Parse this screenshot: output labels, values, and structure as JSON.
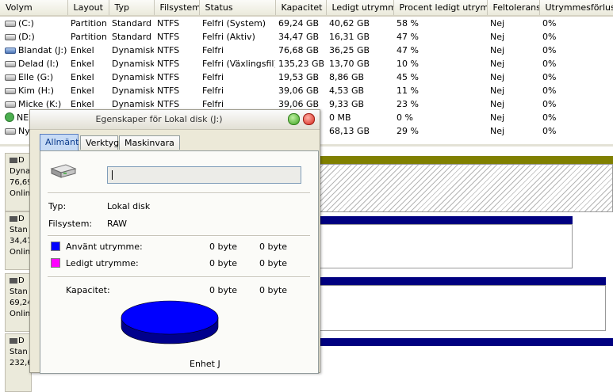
{
  "table": {
    "headers": [
      "Volym",
      "Layout",
      "Typ",
      "Filsystem",
      "Status",
      "Kapacitet",
      "Ledigt utrymme",
      "Procent ledigt utrymme",
      "Feltolerans",
      "Utrymmesförlust"
    ],
    "rows": [
      {
        "icon": "basic-disk-icon",
        "cells": [
          "(C:)",
          "Partition",
          "Standard",
          "NTFS",
          "Felfri (System)",
          "69,24 GB",
          "40,62 GB",
          "58 %",
          "Nej",
          "0%"
        ]
      },
      {
        "icon": "basic-disk-icon",
        "cells": [
          "(D:)",
          "Partition",
          "Standard",
          "NTFS",
          "Felfri (Aktiv)",
          "34,47 GB",
          "16,31 GB",
          "47 %",
          "Nej",
          "0%"
        ]
      },
      {
        "icon": "dynamic-disk-icon",
        "cells": [
          "Blandat (J:)",
          "Enkel",
          "Dynamisk",
          "NTFS",
          "Felfri",
          "76,68 GB",
          "36,25 GB",
          "47 %",
          "Nej",
          "0%"
        ]
      },
      {
        "icon": "basic-disk-icon",
        "cells": [
          "Delad (I:)",
          "Enkel",
          "Dynamisk",
          "NTFS",
          "Felfri (Växlingsfil)",
          "135,23 GB",
          "13,70 GB",
          "10 %",
          "Nej",
          "0%"
        ]
      },
      {
        "icon": "basic-disk-icon",
        "cells": [
          "Elle (G:)",
          "Enkel",
          "Dynamisk",
          "NTFS",
          "Felfri",
          "19,53 GB",
          "8,86 GB",
          "45 %",
          "Nej",
          "0%"
        ]
      },
      {
        "icon": "basic-disk-icon",
        "cells": [
          "Kim (H:)",
          "Enkel",
          "Dynamisk",
          "NTFS",
          "Felfri",
          "39,06 GB",
          "4,53 GB",
          "11 %",
          "Nej",
          "0%"
        ]
      },
      {
        "icon": "basic-disk-icon",
        "cells": [
          "Micke (K:)",
          "Enkel",
          "Dynamisk",
          "NTFS",
          "Felfri",
          "39,06 GB",
          "9,33 GB",
          "23 %",
          "Nej",
          "0%"
        ]
      },
      {
        "icon": "network-drive-icon",
        "cells": [
          "NE",
          "",
          "",
          "",
          "",
          "",
          "0 MB",
          "0 %",
          "Nej",
          "0%"
        ]
      },
      {
        "icon": "basic-disk-icon",
        "cells": [
          "Ny",
          "",
          "",
          "",
          "",
          "",
          "68,13 GB",
          "29 %",
          "Nej",
          "0%"
        ]
      }
    ]
  },
  "disks": [
    {
      "lines": [
        "D",
        "Dyna",
        "76,69",
        "Onlin"
      ]
    },
    {
      "lines": [
        "D",
        "Stan",
        "34,47",
        "Onlin"
      ]
    },
    {
      "lines": [
        "D",
        "Stan",
        "69,24",
        "Onlin"
      ]
    },
    {
      "lines": [
        "D",
        "Stan",
        "232,6"
      ]
    }
  ],
  "dialog": {
    "title": "Egenskaper för Lokal disk (J:)",
    "tabs": {
      "general": "Allmänt",
      "tools": "Verktyg",
      "hardware": "Maskinvara"
    },
    "label_value": "",
    "type_label": "Typ:",
    "type_value": "Lokal disk",
    "fs_label": "Filsystem:",
    "fs_value": "RAW",
    "used_label": "Använt utrymme:",
    "used_bytes": "0 byte",
    "used_gb": "0 byte",
    "free_label": "Ledigt utrymme:",
    "free_bytes": "0 byte",
    "free_gb": "0 byte",
    "cap_label": "Kapacitet:",
    "cap_bytes": "0 byte",
    "cap_gb": "0 byte",
    "drive_caption": "Enhet J",
    "colors": {
      "used": "#0000ff",
      "free": "#ff00ff",
      "pie_side": "#00008c"
    }
  },
  "colors": {
    "olive_bar": "#808000",
    "navy_bar": "#000080"
  }
}
